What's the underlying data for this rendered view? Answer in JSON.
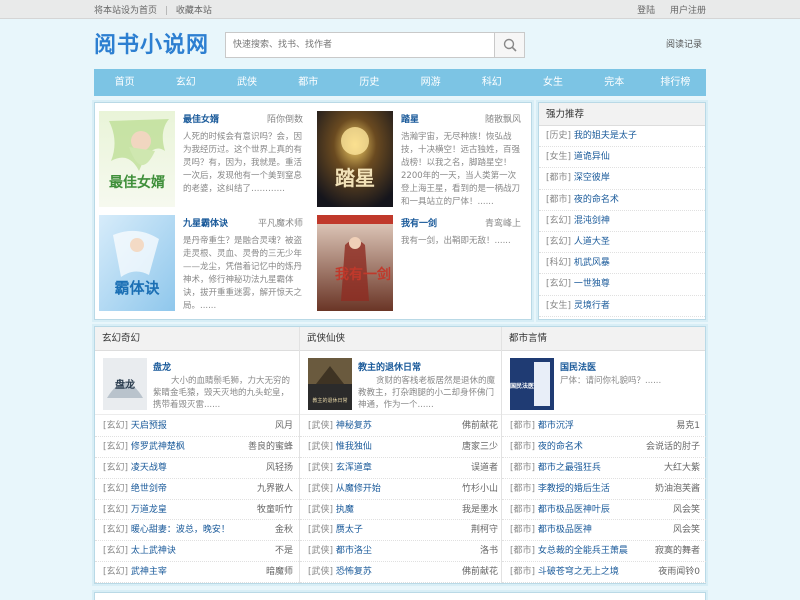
{
  "topbar": {
    "set_home": "将本站设为首页",
    "separator": "|",
    "bookmark": "收藏本站",
    "login": "登陆",
    "register": "用户注册"
  },
  "header": {
    "logo": "阅书小说网",
    "search_placeholder": "快速搜索、找书、找作者",
    "history": "阅读记录"
  },
  "nav": [
    "首页",
    "玄幻",
    "武侠",
    "都市",
    "历史",
    "网游",
    "科幻",
    "女生",
    "完本",
    "排行榜"
  ],
  "featured": [
    {
      "title": "最佳女婿",
      "author": "陌你倒数",
      "desc": "人死的时候会有意识吗？会，因为我经历过。这个世界上真的有灵吗？有，因为，我就是。重活一次后，发现他有一个美到窒息的老婆，这纠结了…………",
      "cover_text": "最佳女婿"
    },
    {
      "title": "踏星",
      "author": "随散飘风",
      "desc": "浩瀚宇宙，无尽种族！恢弘战技，十决横空！远古独姓，百强战榜！以我之名，脚踏星空！2200年的一天，当人类第一次登上海王星，看到的是一柄战刀和一具站立的尸体！......",
      "cover_text": "踏星"
    },
    {
      "title": "九星霸体诀",
      "author": "平凡魔术师",
      "desc": "是丹帝重生？是融合灵魂？被盗走灵根、灵血、灵骨的三无少年——龙尘，凭借着记忆中的炼丹神术，修行神秘功法九星霸体诀，拔开重重迷雾，解开惊天之局。......",
      "cover_text": "霸体诀"
    },
    {
      "title": "我有一剑",
      "author": "青鸾峰上",
      "desc": "我有一剑，出鞘即无敌！......",
      "cover_text": "我有一剑"
    }
  ],
  "recommend": {
    "title": "强力推荐",
    "items": [
      {
        "cat": "[历史]",
        "name": "我的姐夫是太子"
      },
      {
        "cat": "[女生]",
        "name": "道诡异仙"
      },
      {
        "cat": "[都市]",
        "name": "深空彼岸"
      },
      {
        "cat": "[都市]",
        "name": "夜的命名术"
      },
      {
        "cat": "[玄幻]",
        "name": "混沌剑神"
      },
      {
        "cat": "[玄幻]",
        "name": "人道大圣"
      },
      {
        "cat": "[科幻]",
        "name": "机武风暴"
      },
      {
        "cat": "[玄幻]",
        "name": "一世独尊"
      },
      {
        "cat": "[女生]",
        "name": "灵境行者"
      }
    ]
  },
  "sections": [
    {
      "title": "玄幻奇幻",
      "top": {
        "title": "盘龙",
        "desc": "大小的血睛鬃毛狮，力大无穷的紫睛金毛猿，毁天灭地的九头蛇皇，携带着毁灭雷......",
        "cover_text": "盘龙"
      },
      "list": [
        {
          "cat": "[玄幻]",
          "name": "天启预报",
          "author": "风月"
        },
        {
          "cat": "[玄幻]",
          "name": "修罗武神楚枫",
          "author": "善良的蜜蜂"
        },
        {
          "cat": "[玄幻]",
          "name": "凌天战尊",
          "author": "风轻扬"
        },
        {
          "cat": "[玄幻]",
          "name": "绝世剑帝",
          "author": "九界散人"
        },
        {
          "cat": "[玄幻]",
          "name": "万道龙皇",
          "author": "牧童听竹"
        },
        {
          "cat": "[玄幻]",
          "name": "暖心甜妻：波总，晚安！",
          "author": "金秋"
        },
        {
          "cat": "[玄幻]",
          "name": "太上武神诀",
          "author": "不是"
        },
        {
          "cat": "[玄幻]",
          "name": "武神主宰",
          "author": "暗魔师"
        }
      ]
    },
    {
      "title": "武侠仙侠",
      "top": {
        "title": "教主的退休日常",
        "desc": "贪财的客栈老板居然是退休的魔教教主，打杂跑腿的小二却身怀佛门神通，作为一个......",
        "cover_text": "教主的退休日常"
      },
      "list": [
        {
          "cat": "[武侠]",
          "name": "神秘复苏",
          "author": "佛前献花"
        },
        {
          "cat": "[武侠]",
          "name": "惟我独仙",
          "author": "唐家三少"
        },
        {
          "cat": "[武侠]",
          "name": "玄浑道章",
          "author": "误道者"
        },
        {
          "cat": "[武侠]",
          "name": "从魔修开始",
          "author": "竹杉小山"
        },
        {
          "cat": "[武侠]",
          "name": "执魔",
          "author": "我是墨水"
        },
        {
          "cat": "[武侠]",
          "name": "赝太子",
          "author": "荆柯守"
        },
        {
          "cat": "[武侠]",
          "name": "都市洛尘",
          "author": "洛书"
        },
        {
          "cat": "[武侠]",
          "name": "恐怖复苏",
          "author": "佛前献花"
        }
      ]
    },
    {
      "title": "都市言情",
      "top": {
        "title": "国民法医",
        "desc": "尸体：请问你礼貌吗？......",
        "cover_text": "国民法医"
      },
      "list": [
        {
          "cat": "[都市]",
          "name": "都市沉浮",
          "author": "易克1"
        },
        {
          "cat": "[都市]",
          "name": "夜的命名术",
          "author": "会说话的肘子"
        },
        {
          "cat": "[都市]",
          "name": "都市之最强狂兵",
          "author": "大红大紫"
        },
        {
          "cat": "[都市]",
          "name": "李教授的婚后生活",
          "author": "奶油泡芙酱"
        },
        {
          "cat": "[都市]",
          "name": "都市极品医神叶辰",
          "author": "风会笑"
        },
        {
          "cat": "[都市]",
          "name": "都市极品医神",
          "author": "风会笑"
        },
        {
          "cat": "[都市]",
          "name": "女总裁的全能兵王萧晨",
          "author": "寂寞的舞者"
        },
        {
          "cat": "[都市]",
          "name": "斗破苍穹之无上之境",
          "author": "夜雨闻铃0"
        }
      ]
    }
  ],
  "colors": {
    "nav": "#7cc4e4",
    "logo": "#2d7fd1",
    "link": "#1a5a9a",
    "bg": "#e8f6fb"
  }
}
